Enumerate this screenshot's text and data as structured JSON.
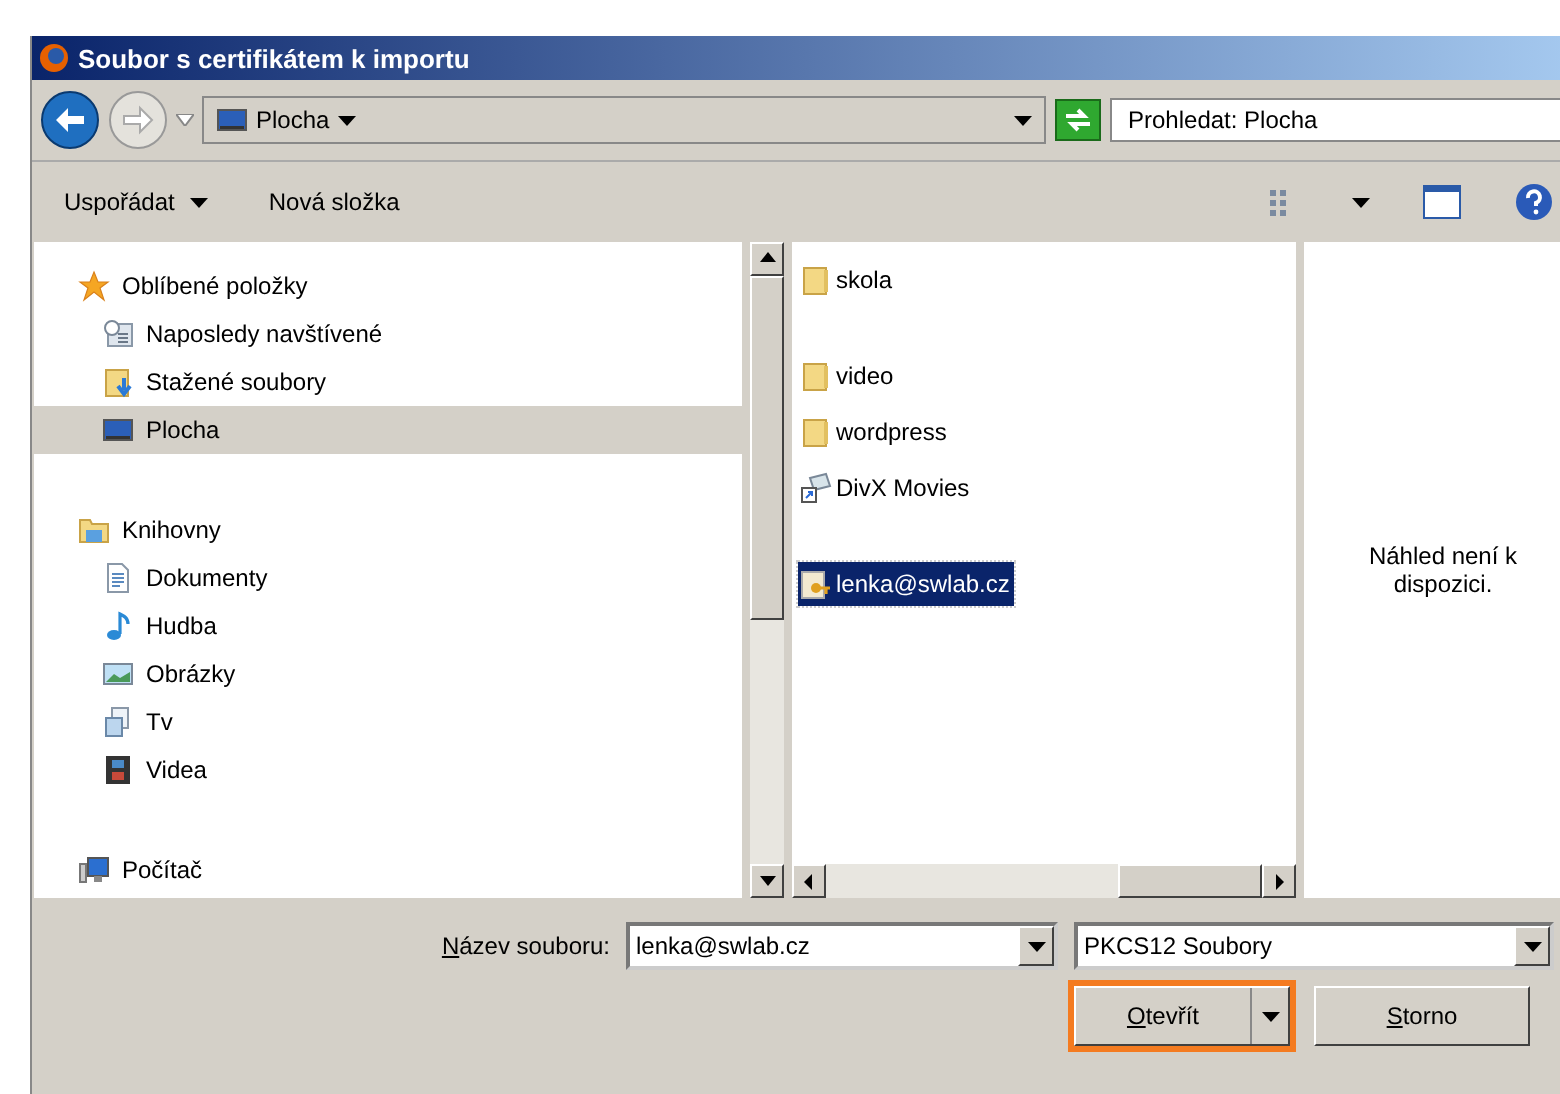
{
  "window": {
    "title": "Soubor s certifikátem k importu"
  },
  "address_bar": {
    "location": "Plocha",
    "search_placeholder": "Prohledat: Plocha"
  },
  "toolbar": {
    "organize": "Uspořádat",
    "new_folder": "Nová složka"
  },
  "sidebar": {
    "groups": [
      {
        "label": "Oblíbené položky",
        "kind": "favorites",
        "children": [
          {
            "label": "Naposledy navštívené",
            "kind": "recent",
            "selected": false
          },
          {
            "label": "Stažené soubory",
            "kind": "downloads",
            "selected": false
          },
          {
            "label": "Plocha",
            "kind": "desktop",
            "selected": true
          }
        ]
      },
      {
        "label": "Knihovny",
        "kind": "libraries",
        "children": [
          {
            "label": "Dokumenty",
            "kind": "documents",
            "selected": false
          },
          {
            "label": "Hudba",
            "kind": "music",
            "selected": false
          },
          {
            "label": "Obrázky",
            "kind": "pictures",
            "selected": false
          },
          {
            "label": "Tv",
            "kind": "tv",
            "selected": false
          },
          {
            "label": "Videa",
            "kind": "videos",
            "selected": false
          }
        ]
      },
      {
        "label": "Počítač",
        "kind": "computer"
      }
    ]
  },
  "files": [
    {
      "name": "skola",
      "kind": "folder",
      "selected": false
    },
    {
      "name": "video",
      "kind": "folder",
      "selected": false
    },
    {
      "name": "wordpress",
      "kind": "folder",
      "selected": false
    },
    {
      "name": "DivX Movies",
      "kind": "shortcut",
      "selected": false
    },
    {
      "name": "lenka@swlab.cz",
      "kind": "certificate",
      "selected": true
    }
  ],
  "preview": {
    "message": "Náhled není k dispozici."
  },
  "bottom": {
    "filename_label": "Název souboru:",
    "filename": "lenka@swlab.cz",
    "filetype": "PKCS12 Soubory",
    "buttons": [
      {
        "label": "Otevřít",
        "kind": "split",
        "highlighted": true
      },
      {
        "label": "Storno",
        "kind": "plain",
        "highlighted": false
      }
    ]
  }
}
